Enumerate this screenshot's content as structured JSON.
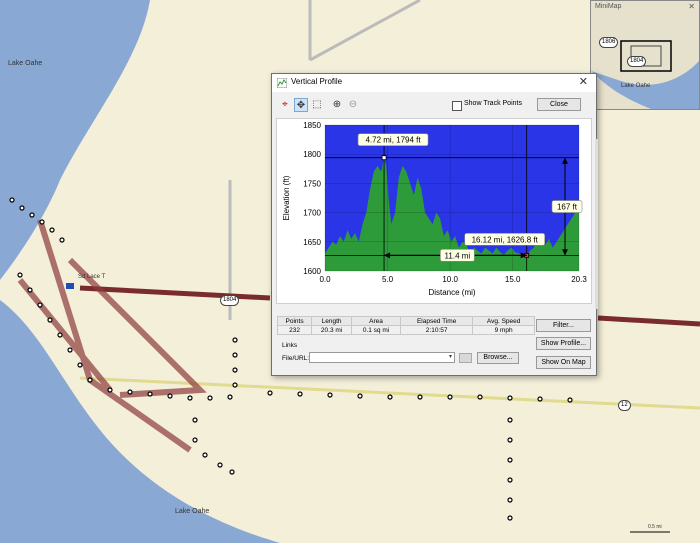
{
  "map": {
    "lake_label_top": "Lake Oahe",
    "lake_label_bottom": "Lake Oahe",
    "waypoint_label": "Sd Lace T",
    "road_shield_1804": "1804",
    "road_shield_12": "12",
    "scale_label": "0.5 mi",
    "colors": {
      "land": "#f4efd9",
      "water": "#8aa8d4",
      "track": "#7a2c2c",
      "highway": "#e8e4a0"
    }
  },
  "minimap": {
    "title": "MiniMap",
    "close": "✕",
    "shield_a": "1806",
    "shield_b": "1804",
    "lake_label": "Lake Oahe"
  },
  "dialog": {
    "title": "Vertical Profile",
    "close_glyph": "✕",
    "show_track_points_label": "Show Track Points",
    "close_button": "Close",
    "filter_button": "Filter...",
    "show_profile_button": "Show Profile...",
    "show_on_map_button": "Show On Map",
    "links_label": "Links",
    "file_url_label": "File/URL:",
    "browse_button": "Browse...",
    "stats": {
      "headers": [
        "Points",
        "Length",
        "Area",
        "Elapsed Time",
        "Avg. Speed"
      ],
      "values": [
        "232",
        "20.3 mi",
        "0.1 sq mi",
        "2:10:57",
        "9 mph"
      ]
    }
  },
  "chart_data": {
    "type": "area",
    "xlabel": "Distance  (mi)",
    "ylabel": "Elevation (ft)",
    "xlim": [
      0.0,
      20.3
    ],
    "ylim": [
      1600,
      1850
    ],
    "x_ticks": [
      "0.0",
      "5.0",
      "10.0",
      "15.0",
      "20.3"
    ],
    "y_ticks": [
      "1600",
      "1650",
      "1700",
      "1750",
      "1800",
      "1850"
    ],
    "colors": {
      "sky": "#2a35e8",
      "ground": "#2e9b3a"
    },
    "x": [
      0.0,
      0.3,
      0.6,
      0.9,
      1.2,
      1.5,
      1.8,
      2.1,
      2.4,
      2.7,
      3.0,
      3.3,
      3.6,
      3.9,
      4.2,
      4.5,
      4.72,
      4.9,
      5.1,
      5.3,
      5.6,
      5.9,
      6.2,
      6.5,
      6.8,
      7.1,
      7.4,
      7.7,
      8.0,
      8.3,
      8.6,
      8.9,
      9.2,
      9.5,
      9.8,
      10.1,
      10.4,
      10.7,
      11.0,
      11.3,
      11.6,
      11.9,
      12.2,
      12.5,
      12.8,
      13.1,
      13.4,
      13.7,
      14.0,
      14.3,
      14.6,
      14.9,
      15.2,
      15.5,
      15.8,
      16.12,
      16.4,
      16.7,
      17.0,
      17.3,
      17.6,
      17.9,
      18.2,
      18.5,
      18.8,
      19.1,
      19.4,
      19.7,
      20.0,
      20.3
    ],
    "y": [
      1630,
      1640,
      1650,
      1645,
      1660,
      1650,
      1670,
      1655,
      1665,
      1650,
      1680,
      1700,
      1740,
      1770,
      1780,
      1770,
      1794,
      1780,
      1720,
      1680,
      1700,
      1760,
      1780,
      1770,
      1750,
      1730,
      1760,
      1740,
      1700,
      1690,
      1680,
      1700,
      1690,
      1660,
      1670,
      1650,
      1660,
      1640,
      1650,
      1645,
      1630,
      1640,
      1635,
      1630,
      1640,
      1635,
      1630,
      1640,
      1632,
      1628,
      1635,
      1640,
      1632,
      1630,
      1628,
      1626.8,
      1635,
      1640,
      1660,
      1650,
      1645,
      1655,
      1640,
      1650,
      1660,
      1670,
      1680,
      1690,
      1700,
      1710
    ],
    "annotations": {
      "max_label": "4.72 mi, 1794 ft",
      "max_point": {
        "x": 4.72,
        "y": 1794
      },
      "cursor_label": "16.12 mi, 1626.8 ft",
      "cursor_point": {
        "x": 16.12,
        "y": 1626.8
      },
      "distance_label": "11.4 mi",
      "elevation_gain_label": "167 ft"
    }
  }
}
